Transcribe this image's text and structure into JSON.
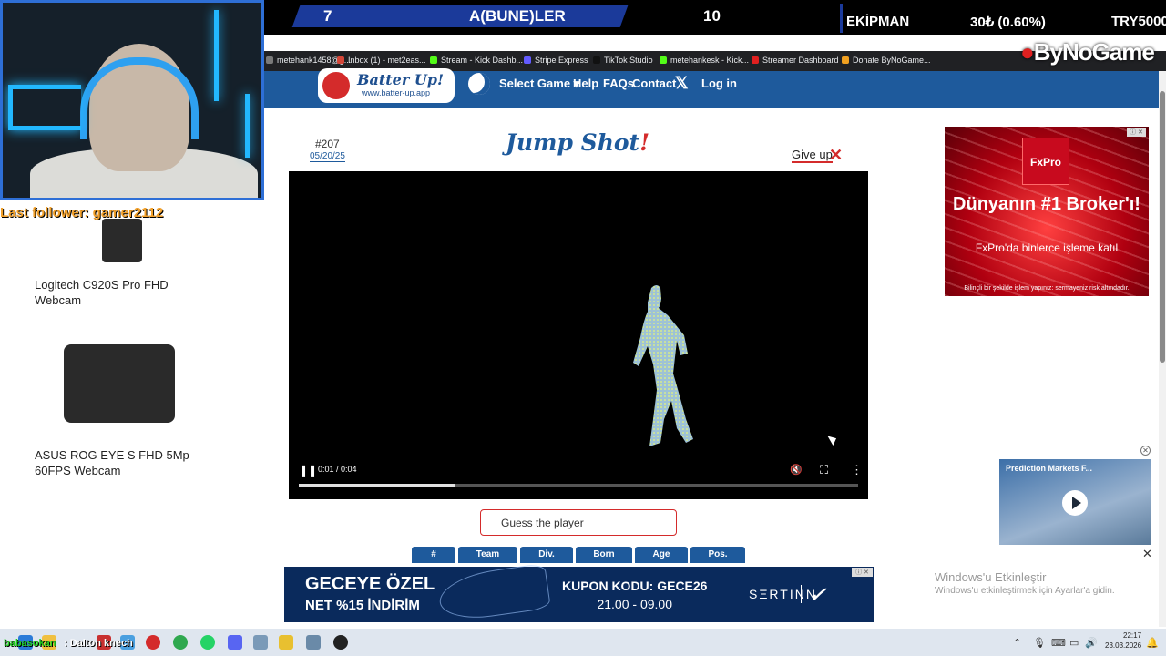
{
  "overlay": {
    "score_left": "7",
    "team_name": "A(BUNE)LER",
    "score_right": "10",
    "ticker_label": "EKİPMAN",
    "ticker_value": "30₺ (0.60%)",
    "ticker_right": "TRY5000",
    "brand": "ByNoGame",
    "last_follower": "Last follower: gamer2112"
  },
  "bookmarks": [
    {
      "label": "metehank1458@g...",
      "color": "#7a7a7a"
    },
    {
      "label": "Inbox (1) - met2eas...",
      "color": "#d44638"
    },
    {
      "label": "Stream - Kick Dashb...",
      "color": "#53fc18"
    },
    {
      "label": "Stripe Express",
      "color": "#635bff"
    },
    {
      "label": "TikTok Studio",
      "color": "#111111"
    },
    {
      "label": "metehankesk - Kick...",
      "color": "#53fc18"
    },
    {
      "label": "Streamer Dashboard",
      "color": "#e02020"
    },
    {
      "label": "Donate ByNoGame...",
      "color": "#f0a020"
    }
  ],
  "site": {
    "logo_title": "Batter Up!",
    "logo_url": "www.batter-up.app",
    "nav": [
      "Select Game ▾",
      "Help",
      "FAQs",
      "Contact",
      "Log in"
    ],
    "x_icon": "𝕏"
  },
  "game": {
    "puzzle_number": "#207",
    "date": "05/20/25",
    "title": "Jump Shot",
    "title_bang": "!",
    "give_up": "Give up",
    "time": "0:01 / 0:04",
    "progress": 0.28,
    "guess_placeholder": "Guess the player",
    "columns": [
      "#",
      "Team",
      "Div.",
      "Born",
      "Age",
      "Pos."
    ]
  },
  "products": [
    {
      "name": "Logitech C920S Pro FHD Webcam"
    },
    {
      "name": "ASUS ROG EYE S FHD 5Mp 60FPS Webcam"
    }
  ],
  "ads": {
    "right_brand": "FxPro",
    "right_headline": "Dünyanın #1 Broker'ı!",
    "right_body": "FxPro'da binlerce işleme katıl",
    "right_disclaimer": "Bilinçli bir şekilde işlem yapınız: sermayeniz risk altındadır.",
    "video_title": "Prediction Markets F...",
    "bottom_left": "GECEYE ÖZEL",
    "bottom_left2": "NET %15 İNDİRİM",
    "bottom_code": "KUPON KODU: GECE26",
    "bottom_hours": "21.00 - 09.00",
    "bottom_brand": "SΞRTINN",
    "bottom_swoosh": "✓"
  },
  "windows": {
    "activate_title": "Windows'u Etkinleştir",
    "activate_body": "Windows'u etkinleştirmek için Ayarlar'a gidin."
  },
  "chat": {
    "user": "babasokan",
    "message": ": Dalton knech"
  },
  "clock": {
    "time": "22:17",
    "date": "23.03.2026"
  }
}
